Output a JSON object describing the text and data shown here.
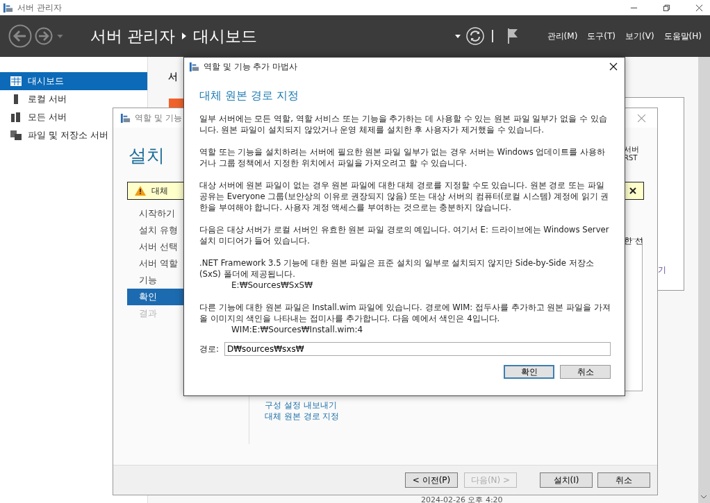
{
  "window": {
    "title": "서버 관리자"
  },
  "header": {
    "breadcrumb": [
      "서버 관리자",
      "대시보드"
    ],
    "menus": [
      "관리(M)",
      "도구(T)",
      "보기(V)",
      "도움말(H)"
    ]
  },
  "sidebar": {
    "items": [
      {
        "label": "대시보드",
        "selected": true,
        "kind": "dashboard"
      },
      {
        "label": "로컬 서버",
        "selected": false,
        "kind": "server"
      },
      {
        "label": "모든 서버",
        "selected": false,
        "kind": "servers"
      },
      {
        "label": "파일 및 저장소 서버",
        "selected": false,
        "kind": "storage"
      }
    ]
  },
  "background": {
    "heading": "서",
    "fragments": [
      "서버",
      "RST",
      "한 선",
      "기"
    ],
    "timestamp": "2024-02-26 오후 4:20"
  },
  "wizard": {
    "title": "역할 및 기능",
    "heading": "설치",
    "warning": "대체",
    "steps": [
      {
        "label": "시작하기",
        "selected": false,
        "disabled": false
      },
      {
        "label": "설치 유형",
        "selected": false,
        "disabled": false
      },
      {
        "label": "서버 선택",
        "selected": false,
        "disabled": false
      },
      {
        "label": "서버 역할",
        "selected": false,
        "disabled": false
      },
      {
        "label": "기능",
        "selected": false,
        "disabled": false
      },
      {
        "label": "확인",
        "selected": true,
        "disabled": false
      },
      {
        "label": "결과",
        "selected": false,
        "disabled": true
      }
    ],
    "links": [
      "구성 설정 내보내기",
      "대체 원본 경로 지정"
    ],
    "buttons": [
      {
        "label": "< 이전(P)",
        "disabled": false
      },
      {
        "label": "다음(N) >",
        "disabled": true
      },
      {
        "label": "설치(I)",
        "disabled": false
      },
      {
        "label": "취소",
        "disabled": false
      }
    ]
  },
  "dialog": {
    "title": "역할 및 기능 추가 마법사",
    "heading": "대체 원본 경로 지정",
    "paragraphs": [
      {
        "text": "일부 서버에는 모든 역할, 역할 서비스 또는 기능을 추가하는 데 사용할 수 있는 원본 파일 일부가 없을 수 있습니다. 원본 파일이 설치되지 않았거나 운영 체제를 설치한 후 사용자가 제거했을 수 있습니다."
      },
      {
        "text": "역할 또는 기능을 설치하려는 서버에 필요한 원본 파일 일부가 없는 경우 서버는 Windows 업데이트를 사용하거나 그룹 정책에서 지정한 위치에서 파일을 가져오려고 할 수 있습니다."
      },
      {
        "text": "대상 서버에 원본 파일이 없는 경우 원본 파일에 대한 대체 경로를 지정할 수도 있습니다. 원본 경로 또는 파일 공유는 Everyone 그룹(보안상의 이유로 권장되지 않음) 또는 대상 서버의 컴퓨터(로컬 시스템) 계정에 읽기 권한을 부여해야 합니다. 사용자 계정 액세스를 부여하는 것으로는 충분하지 않습니다."
      },
      {
        "text": "다음은 대상 서버가 로컬 서버인 유효한 원본 파일 경로의 예입니다. 여기서 E: 드라이브에는 Windows Server 설치 미디어가 들어 있습니다."
      },
      {
        "text": ".NET Framework 3.5 기능에 대한 원본 파일은 표준 설치의 일부로 설치되지 않지만 Side-by-Side 저장소(SxS) 폴더에 제공됩니다.",
        "example": "E:₩Sources₩SxS₩"
      },
      {
        "text": "다른 기능에 대한 원본 파일은 Install.wim 파일에 있습니다. 경로에 WIM: 접두사를 추가하고 원본 파일을 가져올 이미지의 색인을 나타내는 접미사를 추가합니다. 다음 예에서 색인은 4입니다.",
        "example": "WIM:E:₩Sources₩Install.wim:4"
      }
    ],
    "path": {
      "label": "경로:",
      "value": "D₩sources₩sxs₩"
    },
    "buttons": [
      {
        "label": "확인",
        "default": true
      },
      {
        "label": "취소",
        "default": false
      }
    ]
  }
}
